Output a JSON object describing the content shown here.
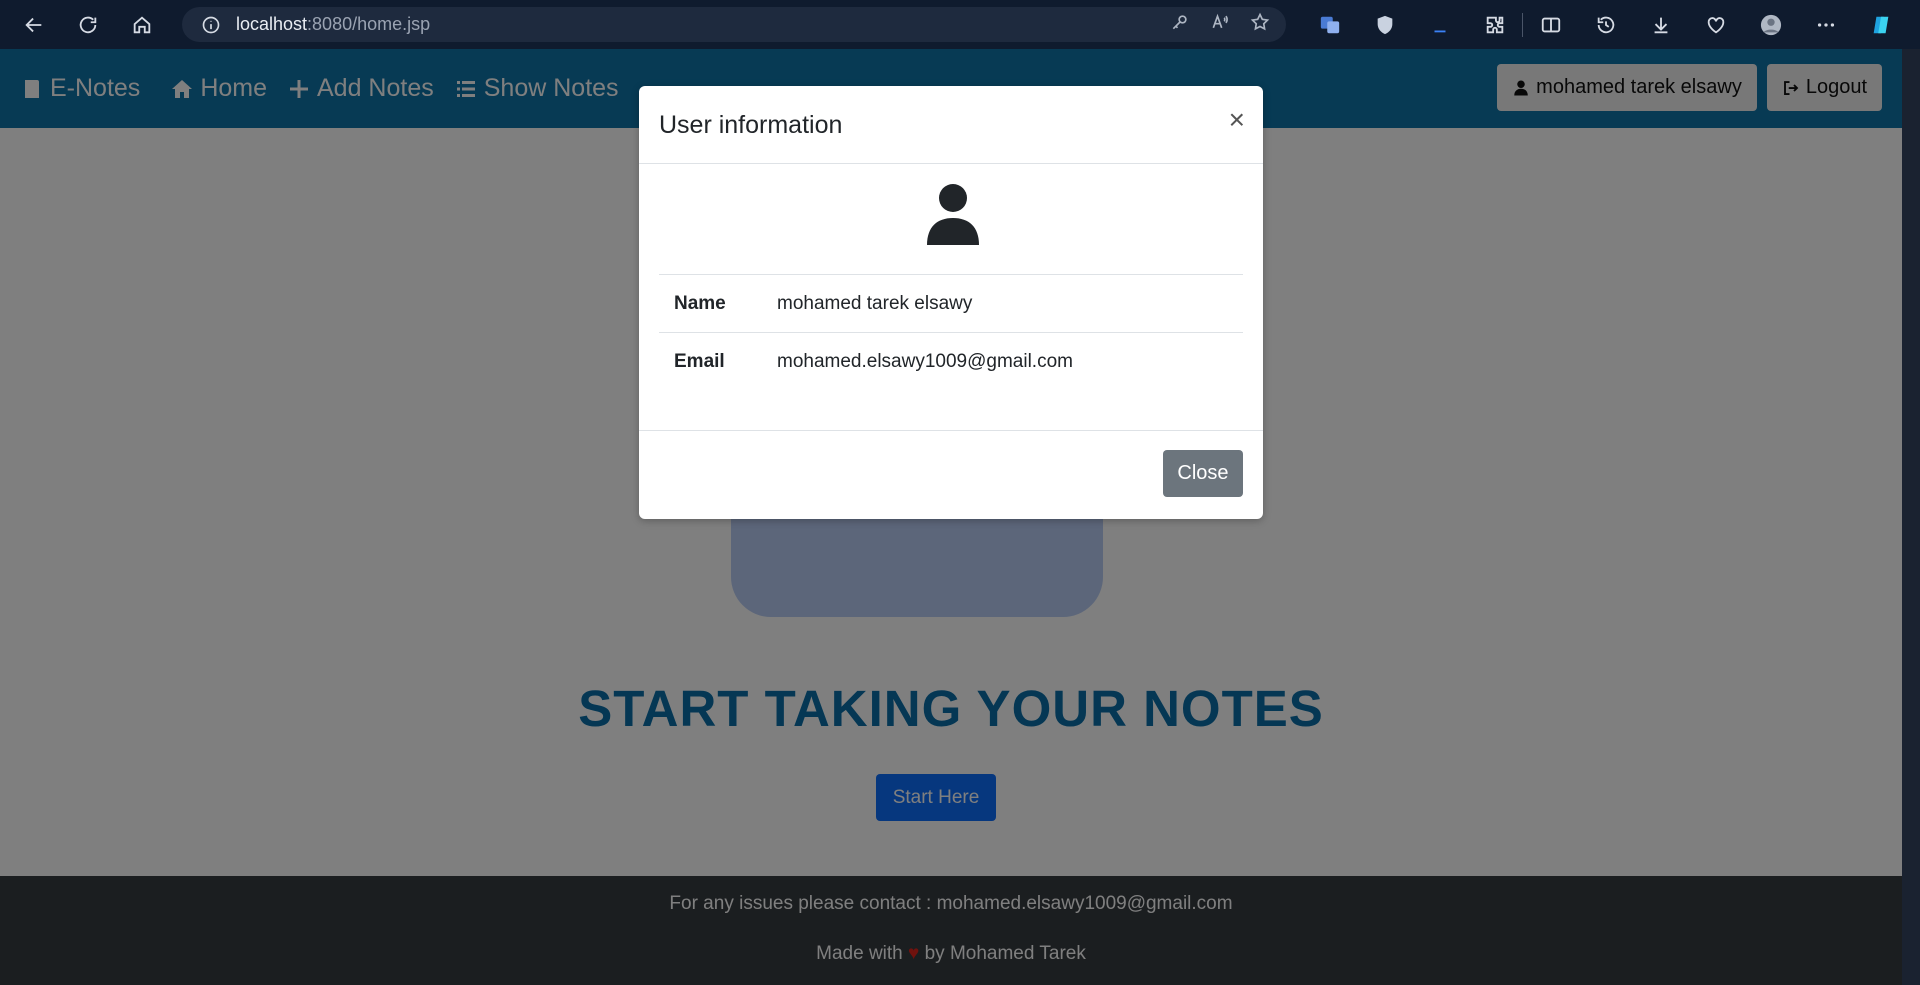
{
  "browser": {
    "url_host": "localhost",
    "url_path": ":8080/home.jsp"
  },
  "nav": {
    "brand": "E-Notes",
    "home": "Home",
    "add_notes": "Add Notes",
    "show_notes": "Show Notes",
    "user_button": "mohamed tarek elsawy",
    "logout": "Logout"
  },
  "hero": {
    "title": "START TAKING YOUR NOTES",
    "start_button": "Start Here"
  },
  "footer": {
    "contact": "For any issues please contact : mohamed.elsawy1009@gmail.com",
    "made_prefix": "Made with",
    "heart": "♥",
    "made_suffix": "by Mohamed Tarek"
  },
  "modal": {
    "title": "User information",
    "close_x": "×",
    "rows": [
      {
        "key": "Name",
        "value": "mohamed tarek elsawy"
      },
      {
        "key": "Email",
        "value": "mohamed.elsawy1009@gmail.com"
      }
    ],
    "close_button": "Close"
  },
  "colors": {
    "nav_bg": "#0e74a8",
    "title_color": "#0a6fa8",
    "primary": "#0d6efd",
    "secondary": "#6c757d",
    "footer_bg": "#373c41"
  }
}
